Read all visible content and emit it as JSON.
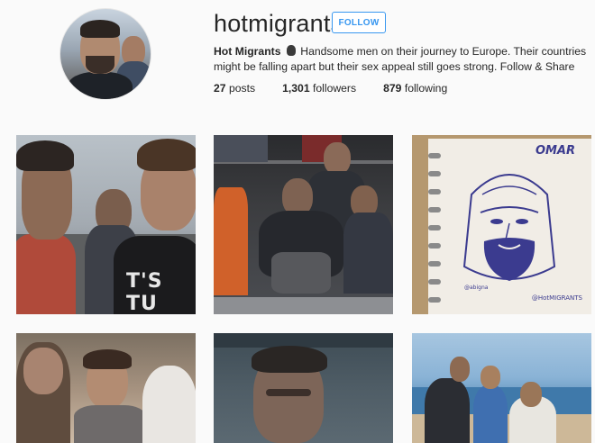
{
  "profile": {
    "username": "hotmigrants",
    "follow_label": "FOLLOW",
    "full_name": "Hot Migrants",
    "bio_text": "Handsome men on their journey to Europe. Their countries might be falling apart but their sex appeal still goes strong. Follow & Share",
    "stats": {
      "posts_count": "27",
      "posts_label": "posts",
      "followers_count": "1,301",
      "followers_label": "followers",
      "following_count": "879",
      "following_label": "following"
    }
  },
  "posts": [
    {
      "id": "post-1",
      "printed_text": "T'S TU"
    },
    {
      "id": "post-2"
    },
    {
      "id": "post-3",
      "printed_text": "OMAR",
      "handle_left": "@abigna",
      "handle_right": "@HotMIGRANTS"
    },
    {
      "id": "post-4"
    },
    {
      "id": "post-5"
    },
    {
      "id": "post-6"
    }
  ],
  "colors": {
    "accent": "#3897f0",
    "text": "#262626",
    "background": "#fafafa",
    "ink": "#3b3b8f"
  },
  "icons": {
    "bio_emoji": "raised-hand-icon"
  }
}
